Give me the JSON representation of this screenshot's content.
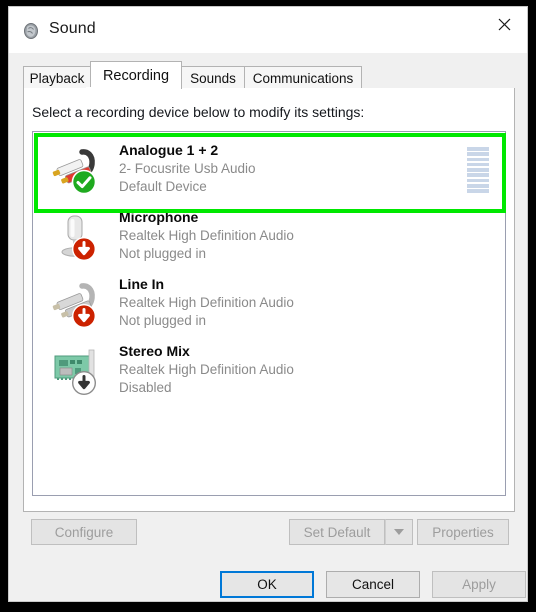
{
  "window": {
    "title": "Sound",
    "icon": "speaker-icon",
    "close_label": "✕"
  },
  "tabs": [
    {
      "label": "Playback",
      "active": false
    },
    {
      "label": "Recording",
      "active": true
    },
    {
      "label": "Sounds",
      "active": false
    },
    {
      "label": "Communications",
      "active": false
    }
  ],
  "instruction": "Select a recording device below to modify its settings:",
  "devices": [
    {
      "name": "Analogue 1 + 2",
      "driver": "2- Focusrite Usb Audio",
      "status": "Default Device",
      "icon": "rca-cable-icon",
      "badge": "green-check-badge",
      "enabled": true,
      "has_meter": true,
      "highlighted": true,
      "meter_segments": 9
    },
    {
      "name": "Microphone",
      "driver": "Realtek High Definition Audio",
      "status": "Not plugged in",
      "icon": "desk-microphone-icon",
      "badge": "red-down-arrow-badge",
      "enabled": false,
      "has_meter": false,
      "highlighted": false,
      "meter_segments": 0
    },
    {
      "name": "Line In",
      "driver": "Realtek High Definition Audio",
      "status": "Not plugged in",
      "icon": "rca-cable-grey-icon",
      "badge": "red-down-arrow-badge",
      "enabled": false,
      "has_meter": false,
      "highlighted": false,
      "meter_segments": 0
    },
    {
      "name": "Stereo Mix",
      "driver": "Realtek High Definition Audio",
      "status": "Disabled",
      "icon": "sound-card-icon",
      "badge": "grey-down-arrow-badge",
      "enabled": false,
      "has_meter": false,
      "highlighted": false,
      "meter_segments": 0
    }
  ],
  "action_buttons": {
    "configure": "Configure",
    "set_default": "Set Default",
    "set_default_dropdown": "chevron-down-icon",
    "properties": "Properties"
  },
  "dialog_buttons": {
    "ok": "OK",
    "cancel": "Cancel",
    "apply": "Apply"
  },
  "colors": {
    "highlight_green": "#00e800",
    "default_badge_green": "#1faa1f",
    "unplugged_badge_red": "#cc2200",
    "focus_blue": "#0078d7",
    "meter_blue": "#c9d6e8"
  }
}
